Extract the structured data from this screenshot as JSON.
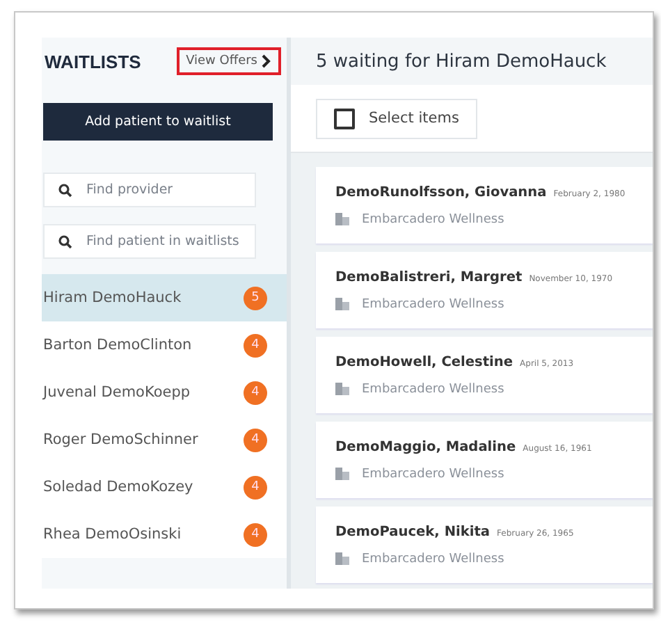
{
  "sidebar": {
    "title": "WAITLISTS",
    "view_offers": {
      "label": "View Offers",
      "highlighted": true
    },
    "add_button": "Add patient to waitlist",
    "search_fields": [
      {
        "placeholder": "Find provider"
      },
      {
        "placeholder": "Find patient in waitlists"
      }
    ],
    "providers": [
      {
        "name": "Hiram DemoHauck",
        "count": "5",
        "selected": true
      },
      {
        "name": "Barton DemoClinton",
        "count": "4",
        "selected": false
      },
      {
        "name": "Juvenal DemoKoepp",
        "count": "4",
        "selected": false
      },
      {
        "name": "Roger DemoSchinner",
        "count": "4",
        "selected": false
      },
      {
        "name": "Soledad DemoKozey",
        "count": "4",
        "selected": false
      },
      {
        "name": "Rhea DemoOsinski",
        "count": "4",
        "selected": false
      }
    ]
  },
  "main": {
    "title": "5 waiting for Hiram DemoHauck",
    "select": {
      "label": "Select items",
      "checked": false
    },
    "patients": [
      {
        "name": "DemoRunolfsson, Giovanna",
        "dob": "February 2, 1980",
        "location": "Embarcadero Wellness"
      },
      {
        "name": "DemoBalistreri, Margret",
        "dob": "November 10, 1970",
        "location": "Embarcadero Wellness"
      },
      {
        "name": "DemoHowell, Celestine",
        "dob": "April 5, 2013",
        "location": "Embarcadero Wellness"
      },
      {
        "name": "DemoMaggio, Madaline",
        "dob": "August 16, 1961",
        "location": "Embarcadero Wellness"
      },
      {
        "name": "DemoPaucek, Nikita",
        "dob": "February 26, 1965",
        "location": "Embarcadero Wellness"
      }
    ]
  }
}
